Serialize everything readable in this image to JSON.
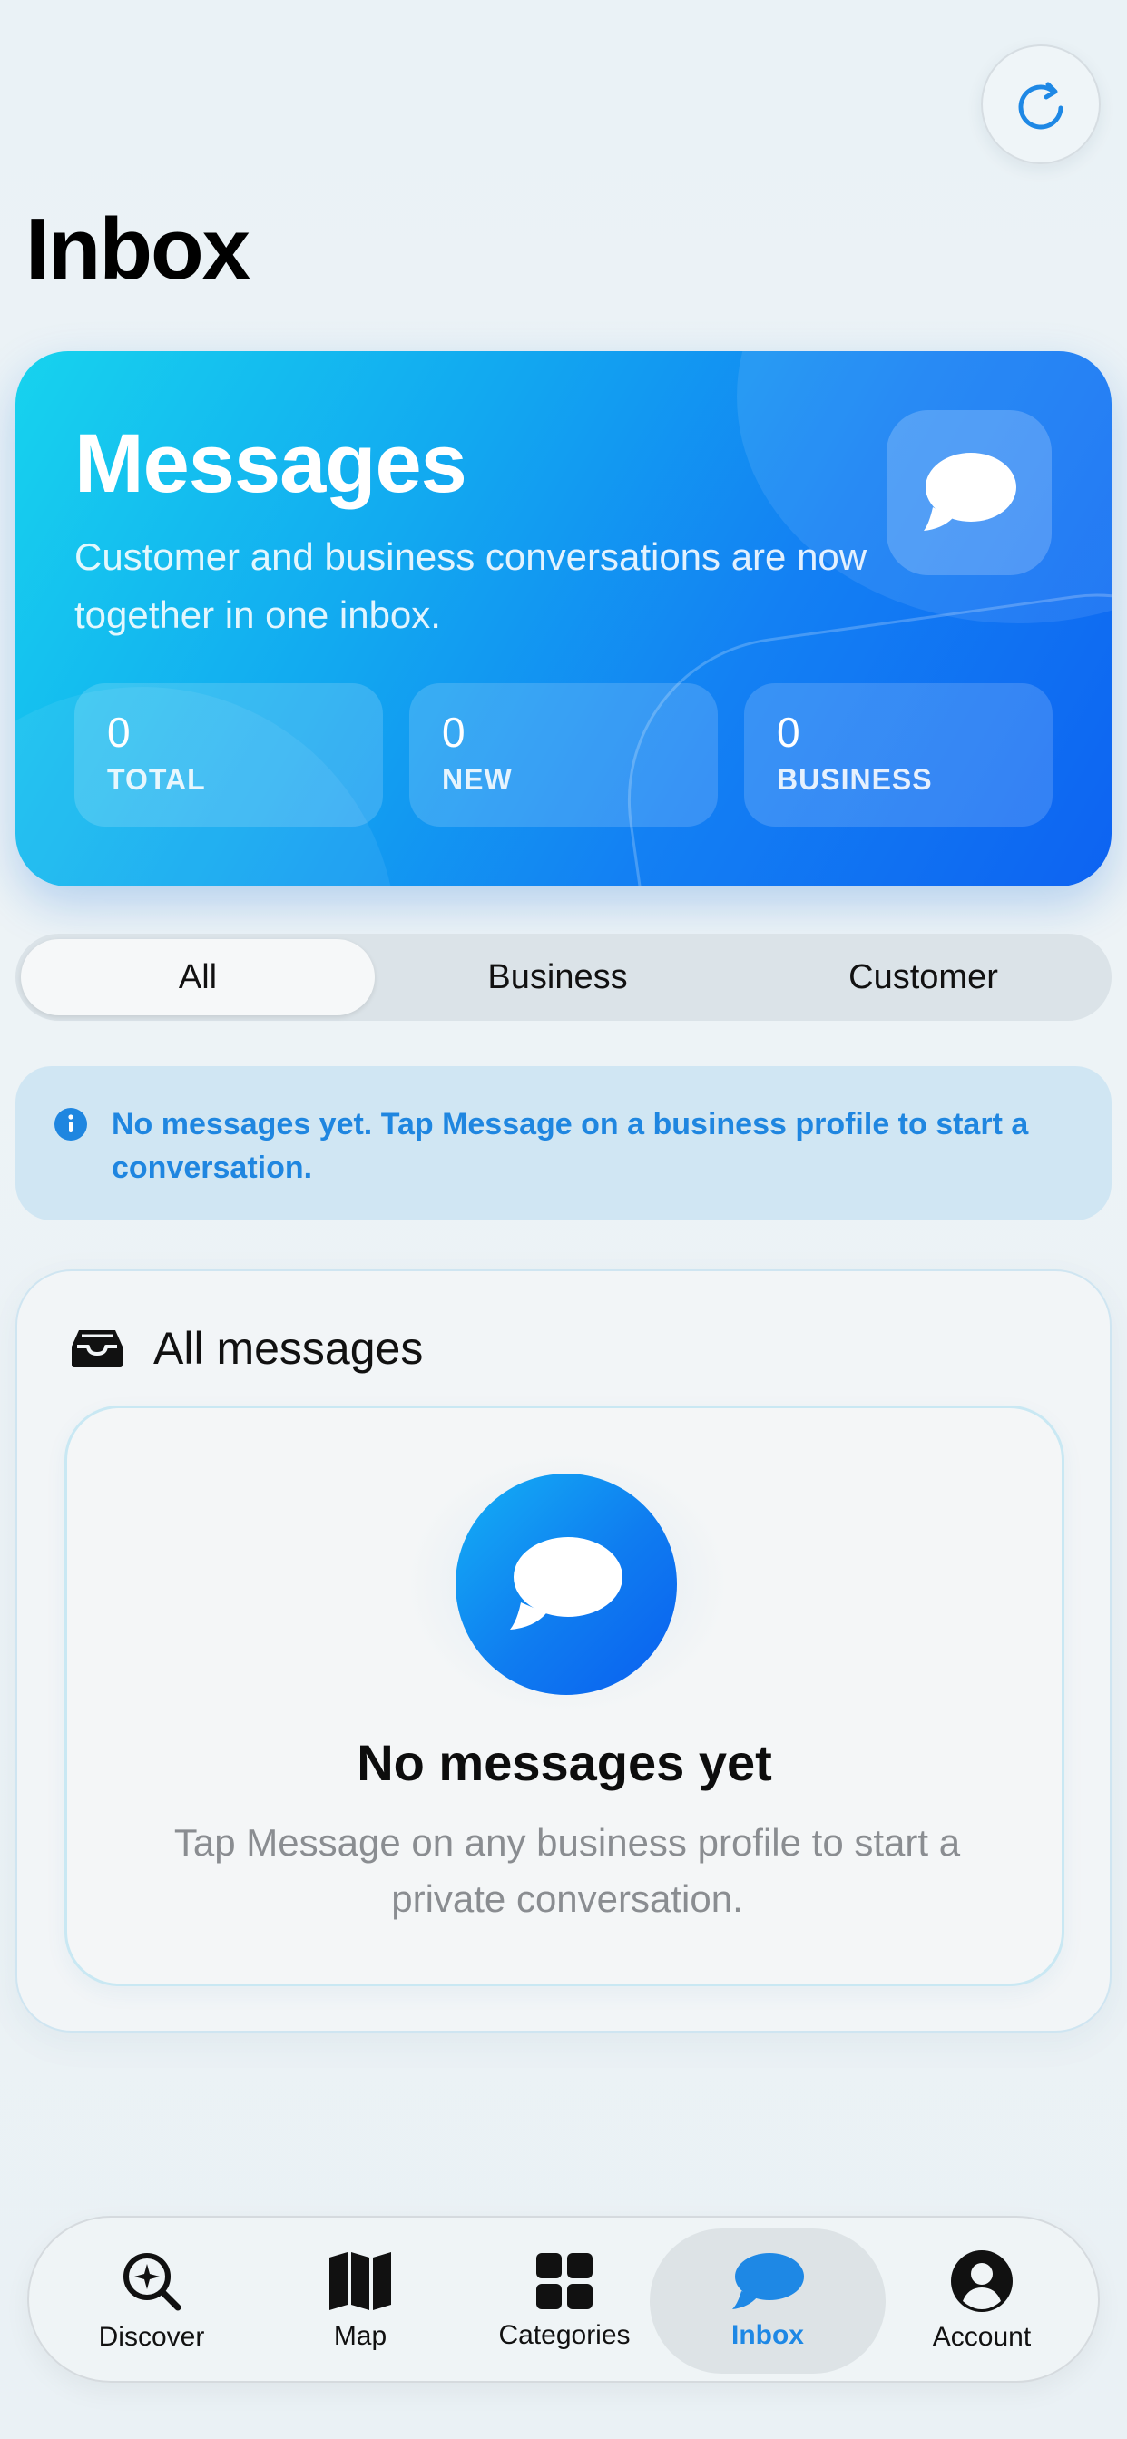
{
  "header": {
    "title": "Inbox",
    "refresh_icon": "refresh-icon"
  },
  "hero": {
    "title": "Messages",
    "subtitle": "Customer and business conversations are now together in one inbox.",
    "icon": "chat-bubble-icon",
    "stats": [
      {
        "value": "0",
        "label": "TOTAL"
      },
      {
        "value": "0",
        "label": "NEW"
      },
      {
        "value": "0",
        "label": "BUSINESS"
      }
    ],
    "colors": {
      "start": "#17d3ee",
      "end": "#0d63f2"
    }
  },
  "filter": {
    "segments": [
      "All",
      "Business",
      "Customer"
    ],
    "selected": "All"
  },
  "info_banner": {
    "icon": "info-icon",
    "text": "No messages yet. Tap Message on a business profile to start a conversation."
  },
  "messages_section": {
    "icon": "inbox-tray-icon",
    "title": "All messages",
    "empty_state": {
      "icon": "chat-bubble-icon",
      "title": "No messages yet",
      "subtitle": "Tap Message on any business profile to start a private conversation."
    }
  },
  "tabbar": {
    "active": "Inbox",
    "accent": "#1e88e5",
    "items": [
      {
        "label": "Discover",
        "icon": "discover-search-icon"
      },
      {
        "label": "Map",
        "icon": "map-icon"
      },
      {
        "label": "Categories",
        "icon": "grid-icon"
      },
      {
        "label": "Inbox",
        "icon": "chat-bubble-icon"
      },
      {
        "label": "Account",
        "icon": "account-icon"
      }
    ]
  }
}
